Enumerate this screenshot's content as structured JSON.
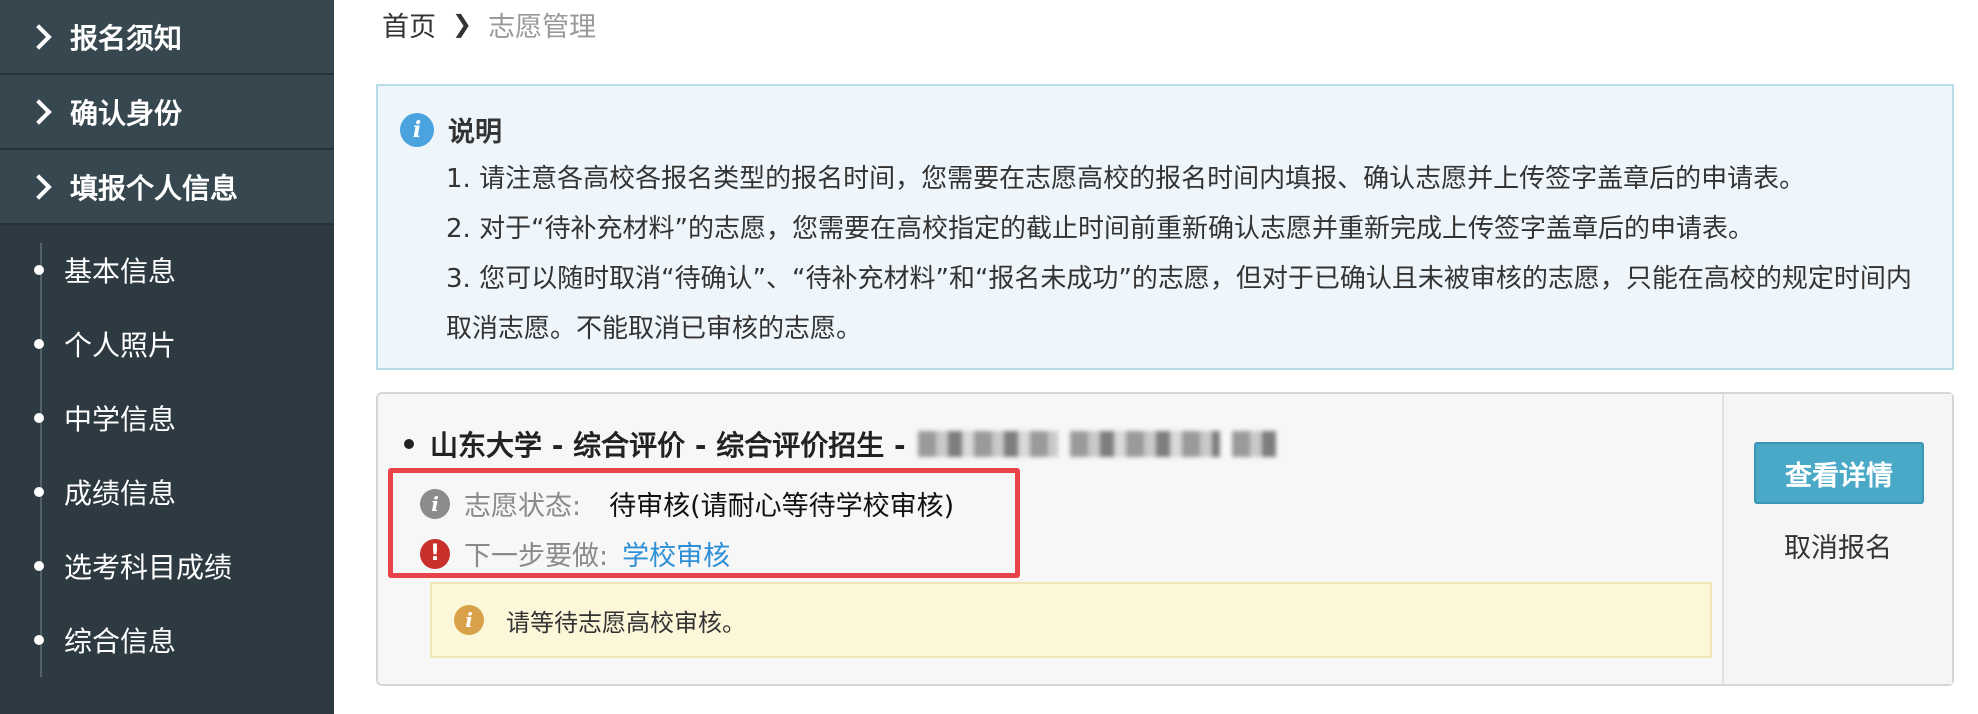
{
  "sidebar": {
    "sections": [
      {
        "label": "报名须知"
      },
      {
        "label": "确认身份"
      },
      {
        "label": "填报个人信息"
      }
    ],
    "sub_items": [
      {
        "label": "基本信息"
      },
      {
        "label": "个人照片"
      },
      {
        "label": "中学信息"
      },
      {
        "label": "成绩信息"
      },
      {
        "label": "选考科目成绩"
      },
      {
        "label": "综合信息"
      }
    ]
  },
  "breadcrumb": {
    "home": "首页",
    "current": "志愿管理"
  },
  "info": {
    "title": "说明",
    "lines": [
      "1. 请注意各高校各报名类型的报名时间，您需要在志愿高校的报名时间内填报、确认志愿并上传签字盖章后的申请表。",
      "2. 对于“待补充材料”的志愿，您需要在高校指定的截止时间前重新确认志愿并重新完成上传签字盖章后的申请表。",
      "3. 您可以随时取消“待确认”、“待补充材料”和“报名未成功”的志愿，但对于已确认且未被审核的志愿，只能在高校的规定时间内取消志愿。不能取消已审核的志愿。"
    ]
  },
  "application": {
    "title": "山东大学 - 综合评价 - 综合评价招生 -",
    "status_label": "志愿状态:",
    "status_value": "待审核(请耐心等待学校审核)",
    "next_label": "下一步要做:",
    "next_value": "学校审核",
    "notice": "请等待志愿高校审核。",
    "detail_button": "查看详情",
    "cancel_link": "取消报名"
  },
  "colors": {
    "sidebar_bg": "#2d3a42",
    "highlight_border": "#e8424a",
    "link": "#2d8fd5",
    "primary_button": "#4ba9c8"
  }
}
